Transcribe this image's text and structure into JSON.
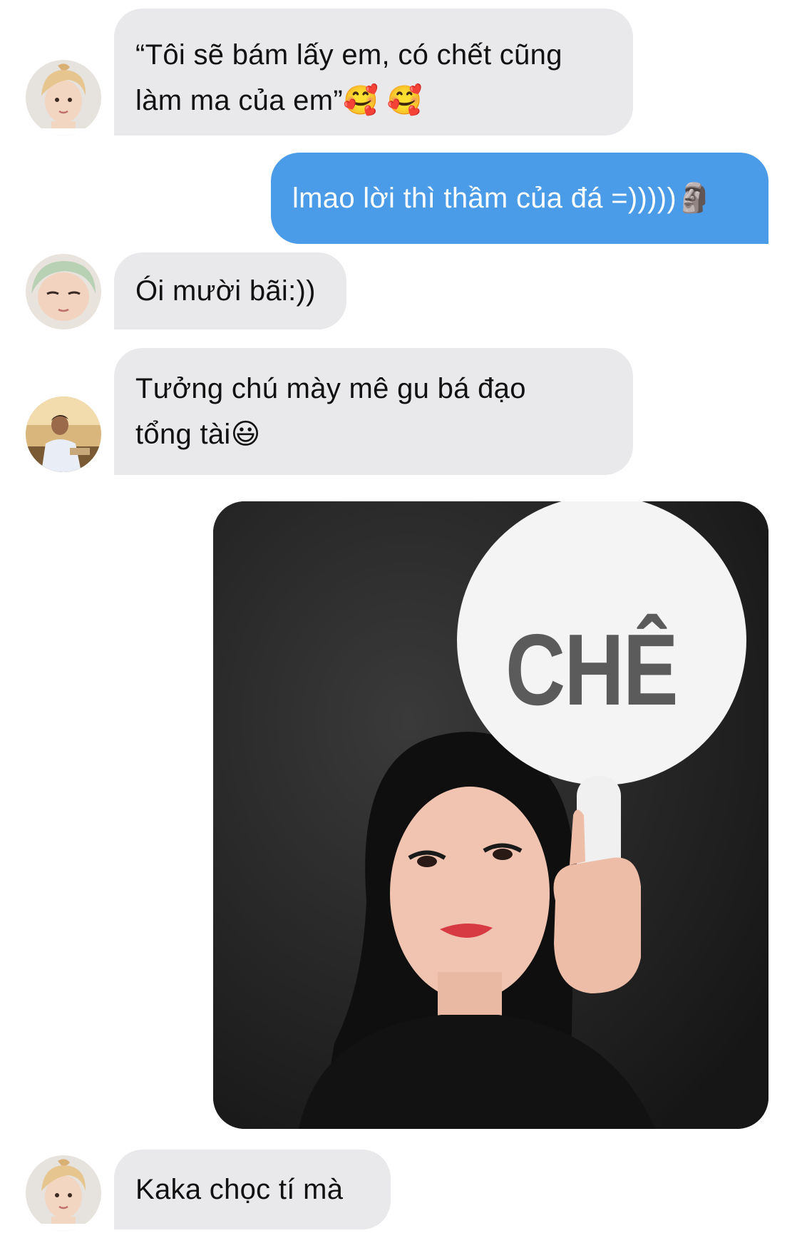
{
  "messages": [
    {
      "sender": "friend-1",
      "direction": "incoming",
      "lines": [
        "“Tôi sẽ bám lấy em, có chết cũng",
        "làm ma của em”🥰 🥰"
      ]
    },
    {
      "sender": "me",
      "direction": "outgoing",
      "lines": [
        "lmao lời thì thầm của đá =)))))🗿"
      ]
    },
    {
      "sender": "friend-2",
      "direction": "incoming",
      "lines": [
        "Ói mười bãi:))"
      ]
    },
    {
      "sender": "friend-3",
      "direction": "incoming",
      "lines": [
        "Tưởng chú mày mê gu bá đạo",
        "tổng tài😃"
      ]
    },
    {
      "sender": "me",
      "direction": "outgoing",
      "type": "image",
      "image": {
        "description_icon": "photo-image",
        "sign_text": "CHÊ"
      }
    },
    {
      "sender": "friend-1",
      "direction": "incoming",
      "lines": [
        "Kaka chọc tí mà"
      ]
    }
  ],
  "colors": {
    "incoming_bubble": "#e9e9eb",
    "outgoing_bubble": "#4a9be8",
    "background": "#ffffff"
  }
}
